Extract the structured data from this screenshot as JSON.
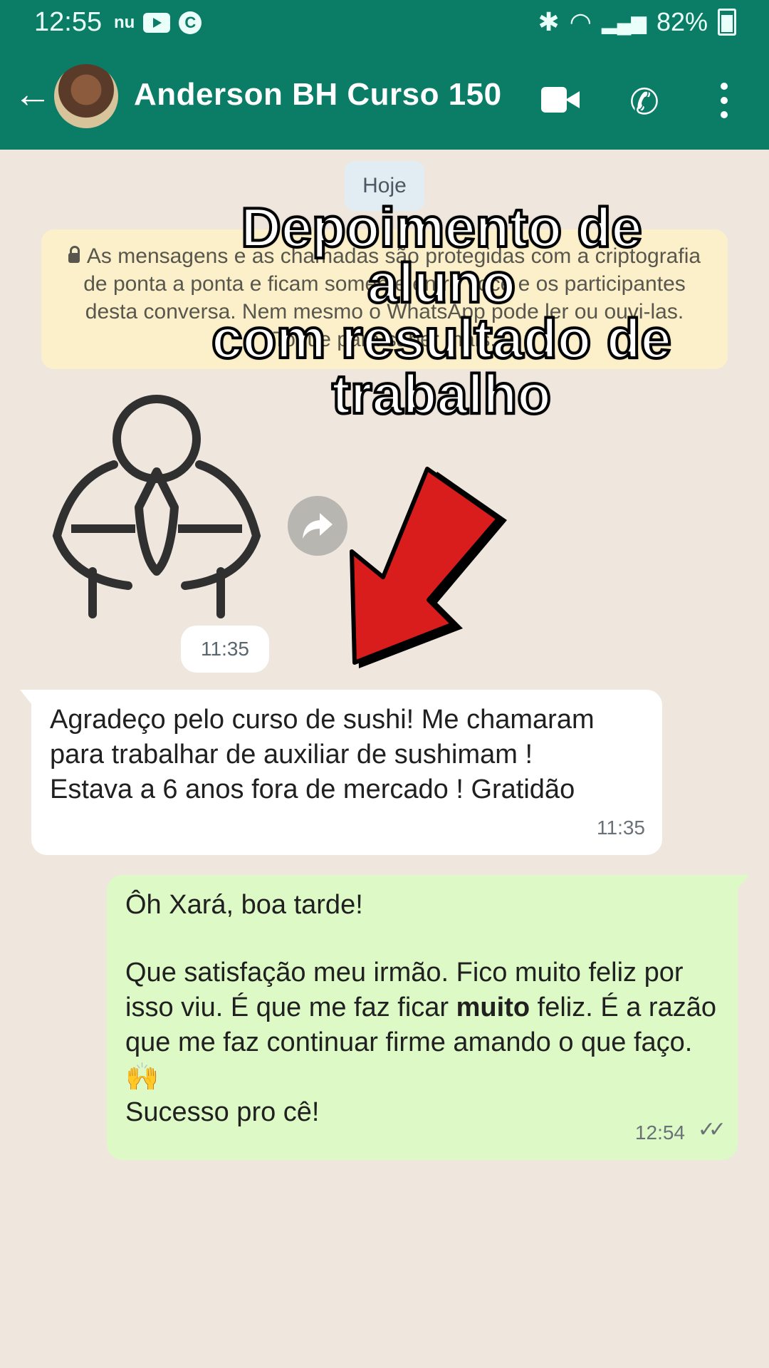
{
  "status_bar": {
    "time": "12:55",
    "small_label": "nu",
    "c_badge": "C",
    "battery": "82%"
  },
  "header": {
    "contact_name": "Anderson BH Curso 150",
    "back_icon": "arrow-back-icon",
    "video_icon": "video-call-icon",
    "phone_icon": "phone-icon",
    "menu_icon": "more-vert-icon"
  },
  "chat": {
    "date_chip": "Hoje",
    "encryption_notice": "As mensagens e as chamadas são protegidas com a criptografia de ponta a ponta e ficam somente entre você e os participantes desta conversa. Nem mesmo o WhatsApp pode ler ou ouvi-las. Toque para saber mais.",
    "sticker_time": "11:35",
    "incoming_message": {
      "text": "Agradeço pelo curso de sushi! Me chamaram para trabalhar de auxiliar de sushimam ! Estava a 6 anos fora de mercado ! Gratidão",
      "time": "11:35"
    },
    "outgoing_message": {
      "line1": "Ôh Xará, boa tarde!",
      "line2_a": "Que satisfação meu irmão. Fico muito feliz por isso viu. É que me faz ficar ",
      "line2_bold": "muito",
      "line2_b": " feliz. É a razão que me faz continuar firme amando o que faço. 🙌",
      "line3": "Sucesso pro cê!",
      "time": "12:54",
      "ticks": "✓✓"
    }
  },
  "overlay": {
    "line1": "Depoimento de",
    "line2": "aluno",
    "line3": "com resultado de",
    "line4": "trabalho"
  },
  "colors": {
    "header": "#0b7d67",
    "chat_bg": "#efe7de",
    "incoming": "#ffffff",
    "outgoing": "#dcf9c6",
    "encryption_bg": "#fbf0c9",
    "arrow": "#d91c1c"
  }
}
